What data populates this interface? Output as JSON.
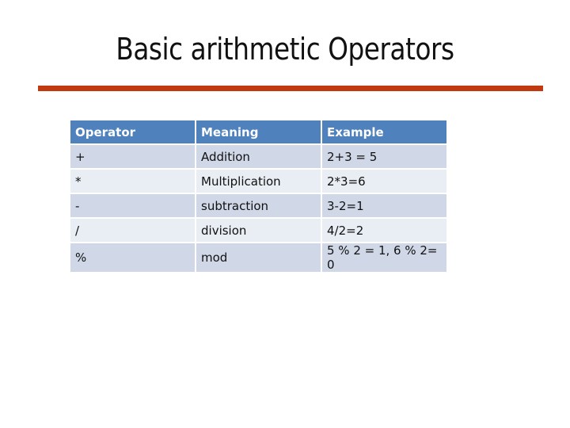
{
  "slide": {
    "title": "Basic arithmetic Operators",
    "accent_color": "#c0390f"
  },
  "table": {
    "headers": [
      "Operator",
      "Meaning",
      "Example"
    ],
    "rows": [
      [
        "+",
        "Addition",
        "2+3 = 5"
      ],
      [
        "*",
        "Multiplication",
        "2*3=6"
      ],
      [
        "-",
        "subtraction",
        "3-2=1"
      ],
      [
        "/",
        "division",
        "4/2=2"
      ],
      [
        "%",
        "mod",
        "5 % 2 = 1, 6 % 2= 0"
      ]
    ],
    "header_color": "#4f81bd",
    "row_color_odd": "#d0d8e8",
    "row_color_even": "#e9edf4"
  }
}
